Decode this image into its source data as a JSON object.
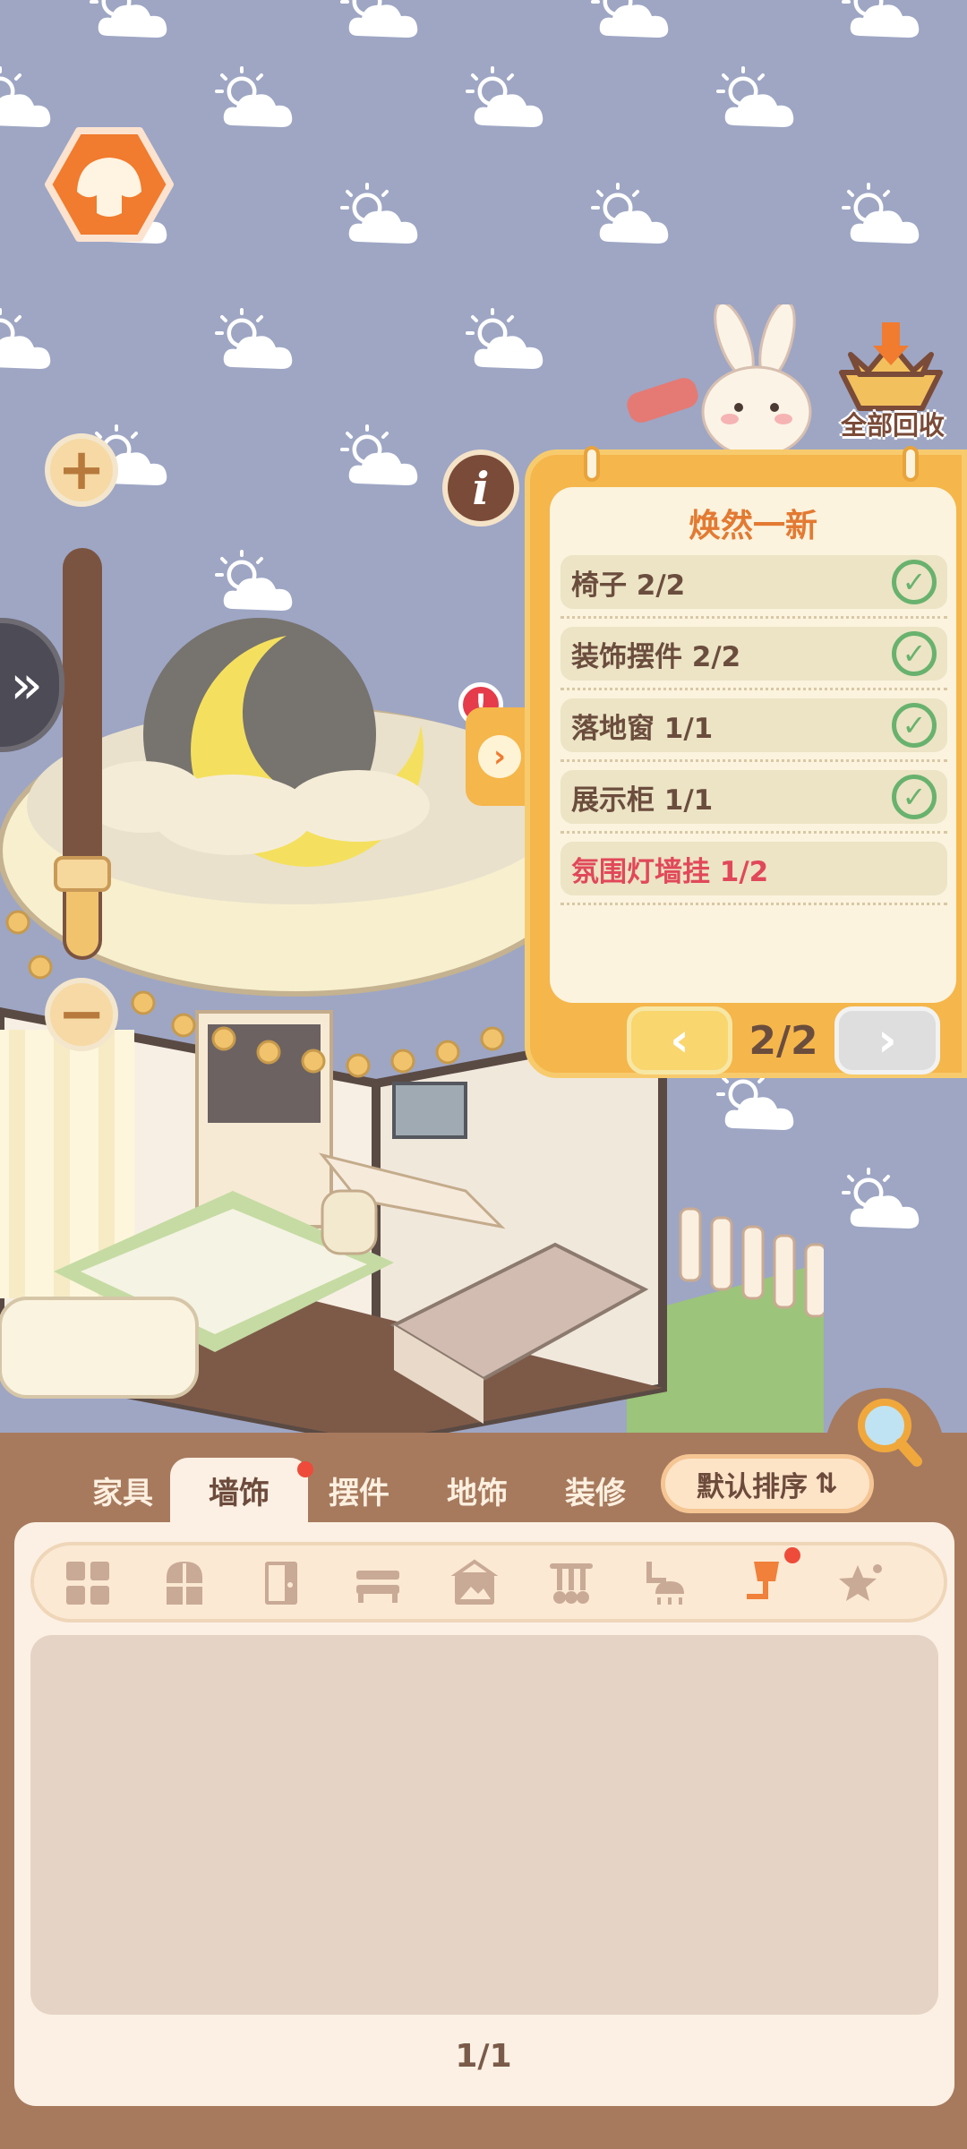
{
  "scene": {
    "task_panel": {
      "title": "焕然一新",
      "items": [
        {
          "label": "椅子 2/2",
          "done": true
        },
        {
          "label": "装饰摆件 2/2",
          "done": true
        },
        {
          "label": "落地窗 1/1",
          "done": true
        },
        {
          "label": "展示柜 1/1",
          "done": true
        },
        {
          "label": "氛围灯墙挂 1/2",
          "done": false
        }
      ],
      "page": "2/2",
      "prev_icon": "chevron-left-icon",
      "next_icon": "chevron-right-icon",
      "check_icon": "check-circle-icon"
    },
    "recycle_all_label": "全部回收",
    "alert_mark": "!",
    "info_mark": "i",
    "colors": {
      "sky": "#9ea6c4",
      "panel": "#f5b64b",
      "accent_orange": "#e37a32",
      "red_text": "#e1485a",
      "bottom": "#a77a5e"
    }
  },
  "bottom": {
    "tabs": [
      {
        "label": "家具",
        "active": false
      },
      {
        "label": "墙饰",
        "active": true,
        "badge": true
      },
      {
        "label": "摆件",
        "active": false
      },
      {
        "label": "地饰",
        "active": false
      },
      {
        "label": "装修",
        "active": false
      }
    ],
    "sort_label": "默认排序",
    "sort_icon": "sort-icon",
    "categories": [
      "all-grid-icon",
      "window-icon",
      "door-icon",
      "shelf-icon",
      "painting-icon",
      "hanger-icon",
      "ceiling-lamp-icon",
      "wall-lamp-icon",
      "star-decor-icon"
    ],
    "page": "1/1"
  }
}
